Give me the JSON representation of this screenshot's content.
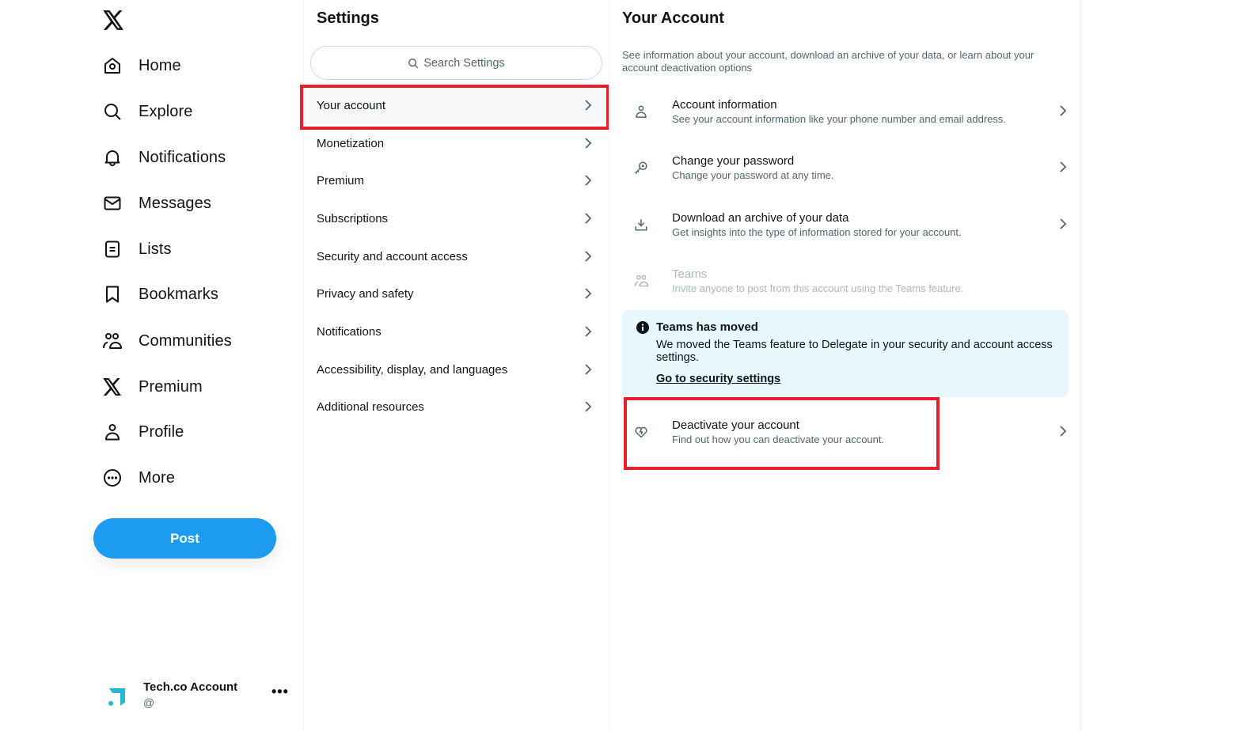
{
  "nav": {
    "logo": "x-logo",
    "items": [
      {
        "label": "Home",
        "icon": "home-icon"
      },
      {
        "label": "Explore",
        "icon": "search-icon"
      },
      {
        "label": "Notifications",
        "icon": "bell-icon"
      },
      {
        "label": "Messages",
        "icon": "envelope-icon"
      },
      {
        "label": "Lists",
        "icon": "list-icon"
      },
      {
        "label": "Bookmarks",
        "icon": "bookmark-icon"
      },
      {
        "label": "Communities",
        "icon": "communities-icon"
      },
      {
        "label": "Premium",
        "icon": "x-premium-icon"
      },
      {
        "label": "Profile",
        "icon": "profile-icon"
      },
      {
        "label": "More",
        "icon": "more-circle-icon"
      }
    ],
    "post_label": "Post",
    "account": {
      "name": "Tech.co Account",
      "handle": "@",
      "more": "•••"
    }
  },
  "settings": {
    "title": "Settings",
    "search_placeholder": "Search Settings",
    "items": [
      {
        "label": "Your account",
        "active": true
      },
      {
        "label": "Monetization"
      },
      {
        "label": "Premium"
      },
      {
        "label": "Subscriptions"
      },
      {
        "label": "Security and account access"
      },
      {
        "label": "Privacy and safety"
      },
      {
        "label": "Notifications"
      },
      {
        "label": "Accessibility, display, and languages"
      },
      {
        "label": "Additional resources"
      }
    ]
  },
  "account_panel": {
    "title": "Your Account",
    "description": "See information about your account, download an archive of your data, or learn about your account deactivation options",
    "rows": [
      {
        "title": "Account information",
        "subtitle": "See your account information like your phone number and email address.",
        "icon": "person-icon"
      },
      {
        "title": "Change your password",
        "subtitle": "Change your password at any time.",
        "icon": "key-icon"
      },
      {
        "title": "Download an archive of your data",
        "subtitle": "Get insights into the type of information stored for your account.",
        "icon": "download-icon"
      },
      {
        "title": "Teams",
        "subtitle": "Invite anyone to post from this account using the Teams feature.",
        "icon": "teams-icon",
        "disabled": true
      },
      {
        "title": "Deactivate your account",
        "subtitle": "Find out how you can deactivate your account.",
        "icon": "broken-heart-icon"
      }
    ],
    "notice": {
      "title": "Teams has moved",
      "body": "We moved the Teams feature to Delegate in your security and account access settings.",
      "link": "Go to security settings"
    }
  },
  "colors": {
    "accent": "#1d9bf0",
    "highlight": "#e5202c",
    "notice_bg": "#e8f8fd"
  }
}
